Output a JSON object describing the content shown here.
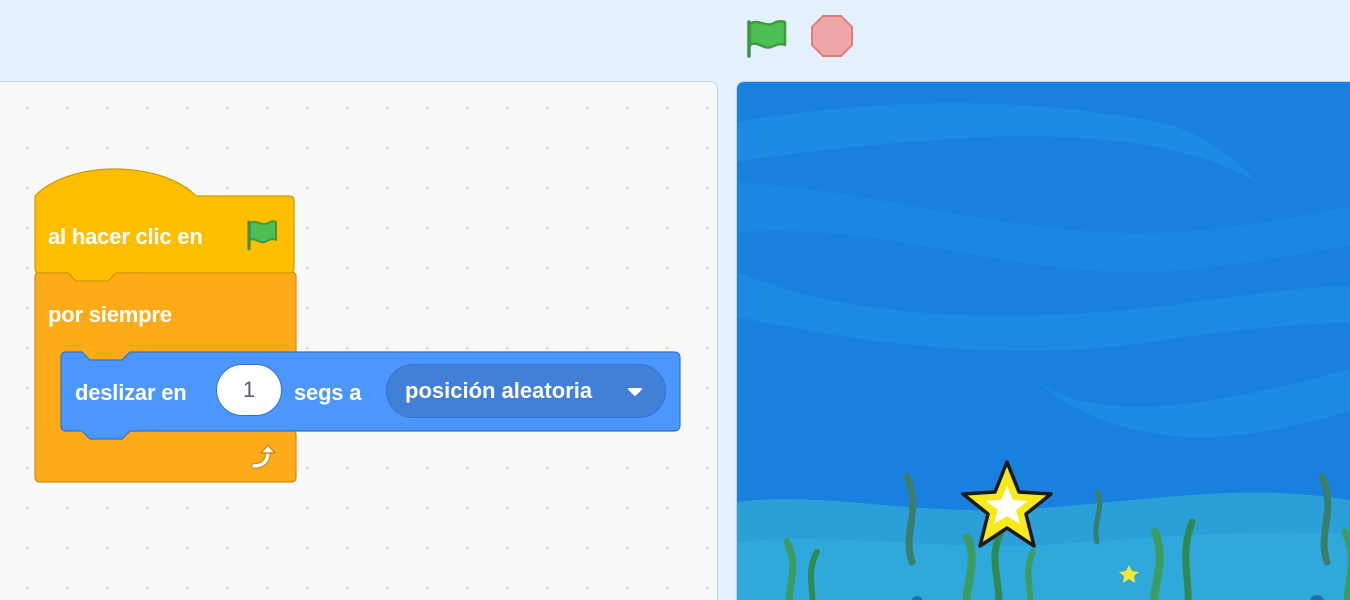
{
  "controls": {
    "green_flag_icon": "green-flag-icon",
    "stop_icon": "stop-sign-icon"
  },
  "script": {
    "hat_block": {
      "label": "al hacer clic en",
      "icon": "green-flag-icon",
      "color": "#ffbf00"
    },
    "forever_block": {
      "label": "por siempre",
      "icon": "loop-arrow-icon",
      "color": "#ffab19"
    },
    "motion_block": {
      "label_before": "deslizar en",
      "seconds_value": "1",
      "label_after": "segs a",
      "target_value": "posición aleatoria",
      "color": "#4c97ff"
    }
  },
  "colors": {
    "events": "#ffbf00",
    "control": "#ffab19",
    "motion": "#4c97ff",
    "flag": "#4cbf56",
    "stop": "#ec5959"
  }
}
